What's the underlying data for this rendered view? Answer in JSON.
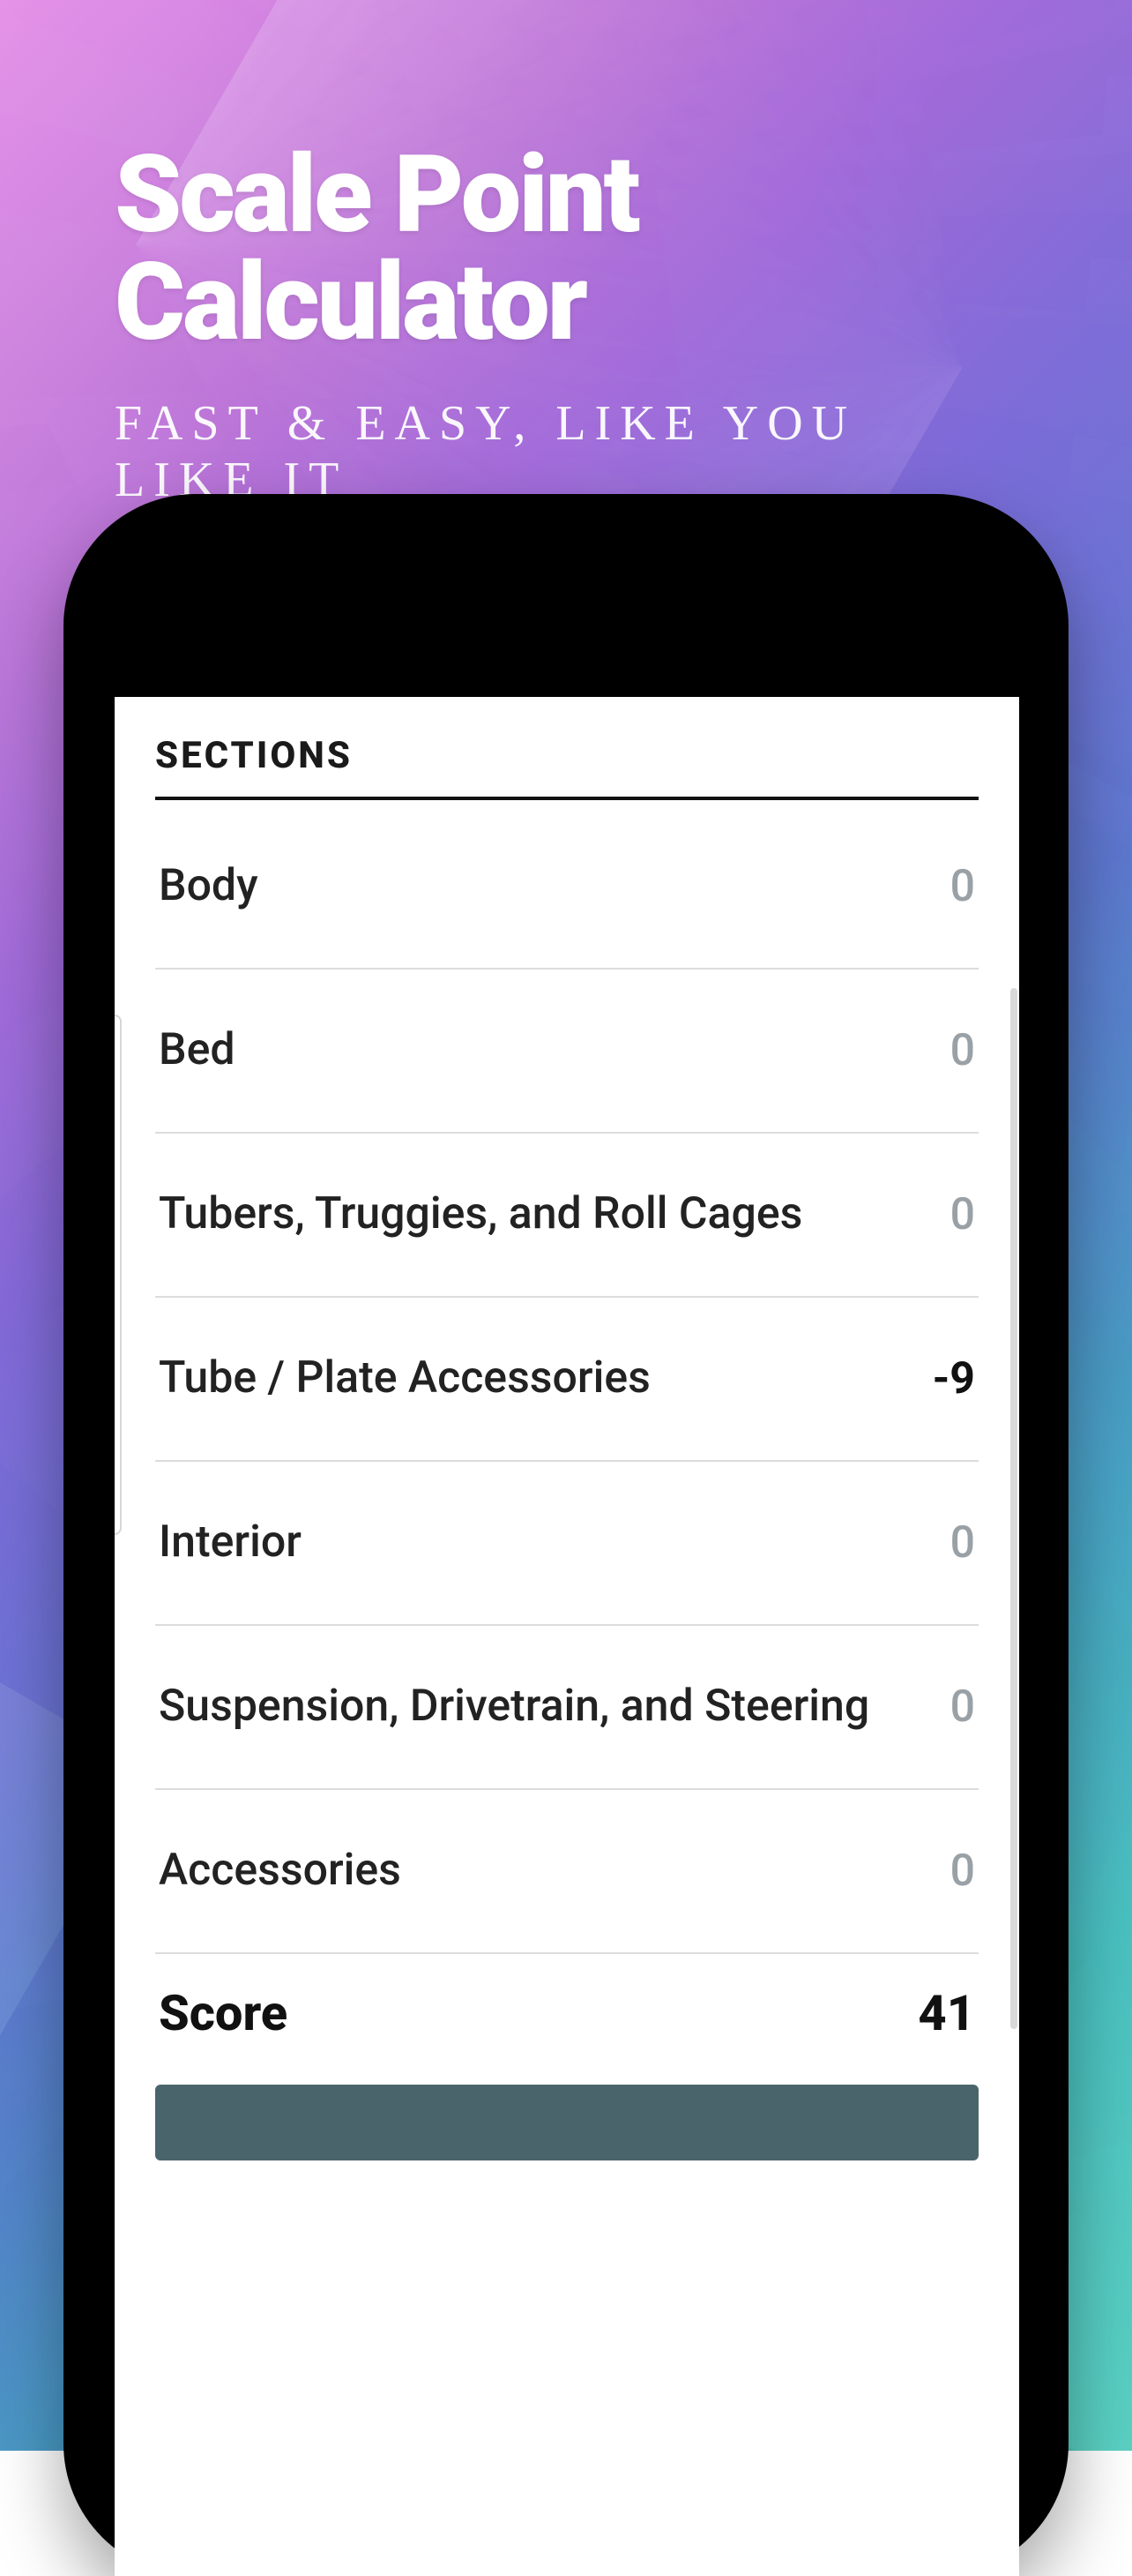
{
  "hero": {
    "title": "Scale Point Calculator",
    "tagline": "FAST & EASY, LIKE YOU LIKE IT"
  },
  "screen": {
    "sections_header": "SECTIONS",
    "rows": [
      {
        "label": "Body",
        "value": "0",
        "nonzero": false
      },
      {
        "label": "Bed",
        "value": "0",
        "nonzero": false
      },
      {
        "label": "Tubers, Truggies, and Roll Cages",
        "value": "0",
        "nonzero": false
      },
      {
        "label": "Tube / Plate Accessories",
        "value": "-9",
        "nonzero": true
      },
      {
        "label": "Interior",
        "value": "0",
        "nonzero": false
      },
      {
        "label": "Suspension, Drivetrain, and Steering",
        "value": "0",
        "nonzero": false
      },
      {
        "label": "Accessories",
        "value": "0",
        "nonzero": false
      }
    ],
    "score_label": "Score",
    "score_value": "41"
  }
}
